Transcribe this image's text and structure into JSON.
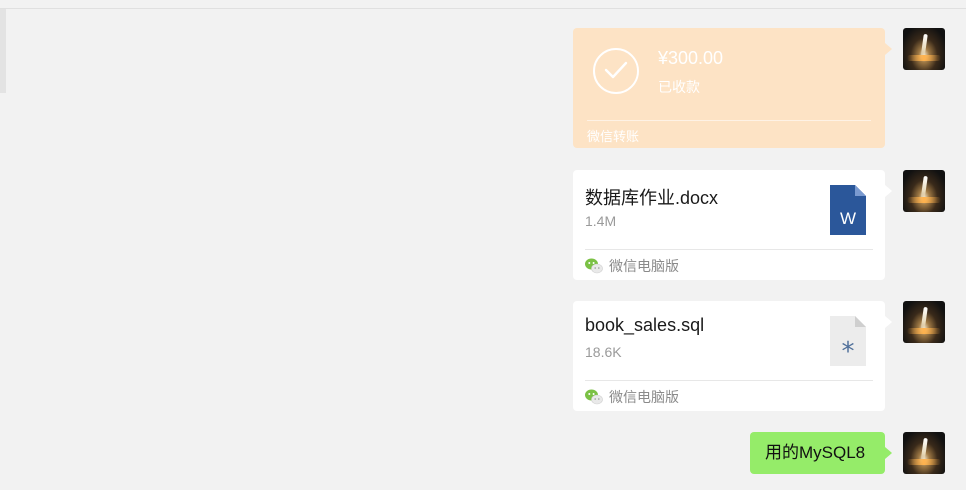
{
  "transfer": {
    "amount": "¥300.00",
    "status": "已收款",
    "footer": "微信转账",
    "color": "#fde3c5"
  },
  "files": [
    {
      "name": "数据库作业.docx",
      "size": "1.4M",
      "source": "微信电脑版",
      "icon": "word-doc-icon"
    },
    {
      "name": "book_sales.sql",
      "size": "18.6K",
      "source": "微信电脑版",
      "icon": "generic-file-icon"
    }
  ],
  "text_message": {
    "text": "用的MySQL8",
    "color": "#95ec69"
  }
}
